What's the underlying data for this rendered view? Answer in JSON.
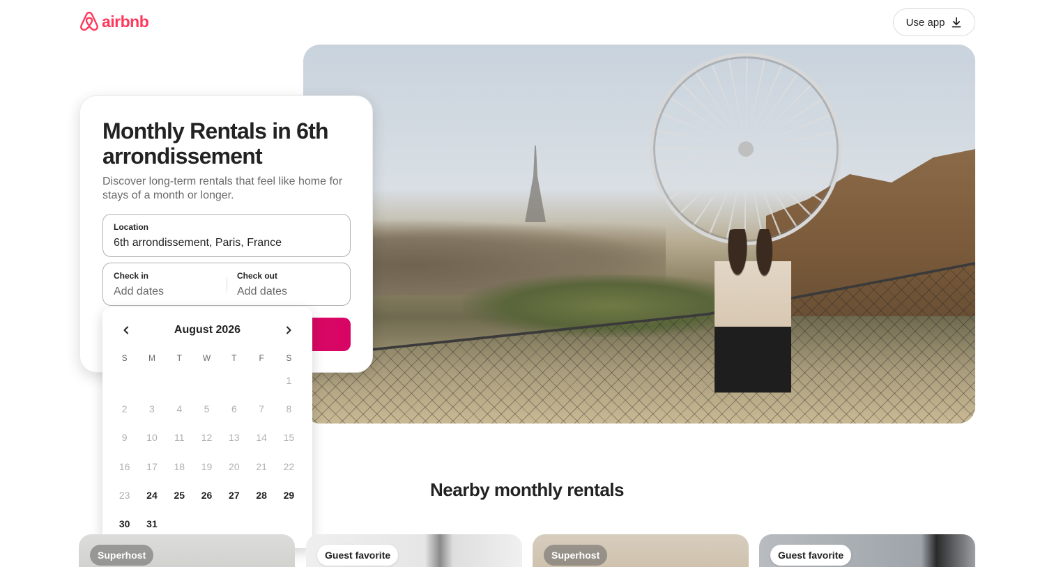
{
  "header": {
    "logo_text": "airbnb",
    "use_app_label": "Use app"
  },
  "search": {
    "title": "Monthly Rentals in 6th arrondissement",
    "subtitle": "Discover long-term rentals that feel like home for stays of a month or longer.",
    "location_label": "Location",
    "location_value": "6th arrondissement, Paris, France",
    "checkin_label": "Check in",
    "checkin_placeholder": "Add dates",
    "checkout_label": "Check out",
    "checkout_placeholder": "Add dates"
  },
  "calendar": {
    "month": "August 2026",
    "weekdays": [
      "S",
      "M",
      "T",
      "W",
      "T",
      "F",
      "S"
    ],
    "leading_blanks": 6,
    "days": [
      {
        "n": "1",
        "available": false
      },
      {
        "n": "2",
        "available": false
      },
      {
        "n": "3",
        "available": false
      },
      {
        "n": "4",
        "available": false
      },
      {
        "n": "5",
        "available": false
      },
      {
        "n": "6",
        "available": false
      },
      {
        "n": "7",
        "available": false
      },
      {
        "n": "8",
        "available": false
      },
      {
        "n": "9",
        "available": false
      },
      {
        "n": "10",
        "available": false
      },
      {
        "n": "11",
        "available": false
      },
      {
        "n": "12",
        "available": false
      },
      {
        "n": "13",
        "available": false
      },
      {
        "n": "14",
        "available": false
      },
      {
        "n": "15",
        "available": false
      },
      {
        "n": "16",
        "available": false
      },
      {
        "n": "17",
        "available": false
      },
      {
        "n": "18",
        "available": false
      },
      {
        "n": "19",
        "available": false
      },
      {
        "n": "20",
        "available": false
      },
      {
        "n": "21",
        "available": false
      },
      {
        "n": "22",
        "available": false
      },
      {
        "n": "23",
        "available": false
      },
      {
        "n": "24",
        "available": true
      },
      {
        "n": "25",
        "available": true
      },
      {
        "n": "26",
        "available": true
      },
      {
        "n": "27",
        "available": true
      },
      {
        "n": "28",
        "available": true
      },
      {
        "n": "29",
        "available": true
      },
      {
        "n": "30",
        "available": true
      },
      {
        "n": "31",
        "available": true
      }
    ]
  },
  "nearby": {
    "title": "Nearby monthly rentals",
    "listings": [
      {
        "badge": "Superhost"
      },
      {
        "badge": "Guest favorite"
      },
      {
        "badge": "Superhost"
      },
      {
        "badge": "Guest favorite"
      }
    ]
  },
  "colors": {
    "brand": "#FF385C",
    "search_button": "#E61E4D"
  }
}
